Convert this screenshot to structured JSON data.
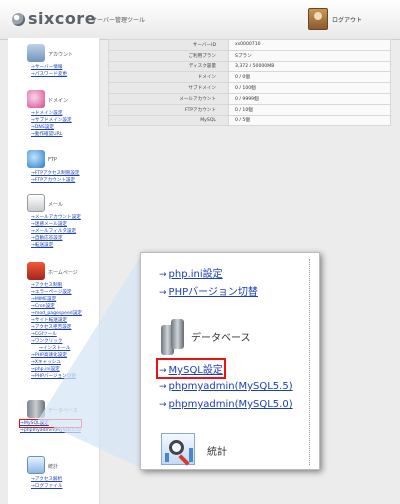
{
  "header": {
    "logo_text": "sixcore",
    "logo_sub": "サーバー管理ツール",
    "logout_label": "ログアウト"
  },
  "sidebar": {
    "sections": [
      {
        "title": "アカウント",
        "icon": "account-icon",
        "links": [
          "サーバー情報",
          "パスワード変更"
        ]
      },
      {
        "title": "ドメイン",
        "icon": "domain-icon",
        "links": [
          "ドメイン設定",
          "サブドメイン設定",
          "DNS設定",
          "動作確認URL"
        ]
      },
      {
        "title": "FTP",
        "icon": "ftp-icon",
        "links": [
          "FTPアクセス制限設定",
          "FTPアカウント設定"
        ]
      },
      {
        "title": "メール",
        "icon": "mail-icon",
        "links": [
          "メールアカウント設定",
          "迷惑メール設定",
          "メールフィルタ設定",
          "自動応答設定",
          "転送設定"
        ]
      },
      {
        "title": "ホームページ",
        "icon": "home-icon",
        "links": [
          "アクセス制限",
          "エラーページ設定",
          "MIME設定",
          "Cron設定",
          "mod_pagespeed設定",
          "サイト転送設定",
          "アクセス拒否設定",
          "CGIツール",
          "ワンクリック",
          "インストール",
          "PHP高速化設定",
          "Xキャッシュ",
          "php.ini設定",
          "PHPバージョン切替"
        ]
      },
      {
        "title": "データベース",
        "icon": "database-icon",
        "links": [
          "MySQL設定",
          "phpmyadmin(MySQL5.5)"
        ]
      },
      {
        "title": "統計",
        "icon": "stats-icon",
        "links": [
          "アクセス解析",
          "ログファイル"
        ]
      }
    ]
  },
  "info_table": [
    {
      "key": "サーバーID",
      "value": "xs0000710"
    },
    {
      "key": "ご利用プラン",
      "value": "Sプラン"
    },
    {
      "key": "ディスク容量",
      "value": "3,372 / 50000MB"
    },
    {
      "key": "ドメイン",
      "value": "0 / 0個"
    },
    {
      "key": "サブドメイン",
      "value": "0 / 100個"
    },
    {
      "key": "メールアカウント",
      "value": "0 / 9999個"
    },
    {
      "key": "FTPアカウント",
      "value": "0 / 10個"
    },
    {
      "key": "MySQL",
      "value": "0 / 5個"
    }
  ],
  "callout": {
    "link_phpini": "php.ini設定",
    "link_phpver": "PHPバージョン切替",
    "db_title": "データベース",
    "link_mysql": "MySQL設定",
    "link_pma55": "phpmyadmin(MySQL5.5)",
    "link_pma50": "phpmyadmin(MySQL5.0)",
    "stats_title": "統計"
  },
  "colors": {
    "link": "#1a3fb8",
    "highlight": "#ee1111"
  }
}
